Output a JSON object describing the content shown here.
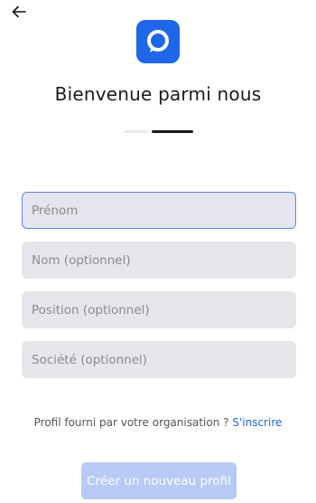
{
  "header": {
    "back_icon": "arrow-left-icon",
    "logo_icon": "chat-bubble-logo",
    "title": "Bienvenue parmi nous"
  },
  "steps": {
    "current": 2,
    "total": 2
  },
  "form": {
    "first_name": {
      "placeholder": "Prénom",
      "value": ""
    },
    "last_name": {
      "placeholder": "Nom (optionnel)",
      "value": ""
    },
    "position": {
      "placeholder": "Position (optionnel)",
      "value": ""
    },
    "company": {
      "placeholder": "Société (optionnel)",
      "value": ""
    }
  },
  "helper": {
    "text": "Profil fourni par votre organisation ?",
    "link": "S'inscrire"
  },
  "submit": {
    "label": "Créer un nouveau profil"
  },
  "colors": {
    "accent": "#1f66e8",
    "button_disabled": "#b7c9f4",
    "field_bg": "#e6e6ea",
    "focus_border": "#5b83e8"
  }
}
